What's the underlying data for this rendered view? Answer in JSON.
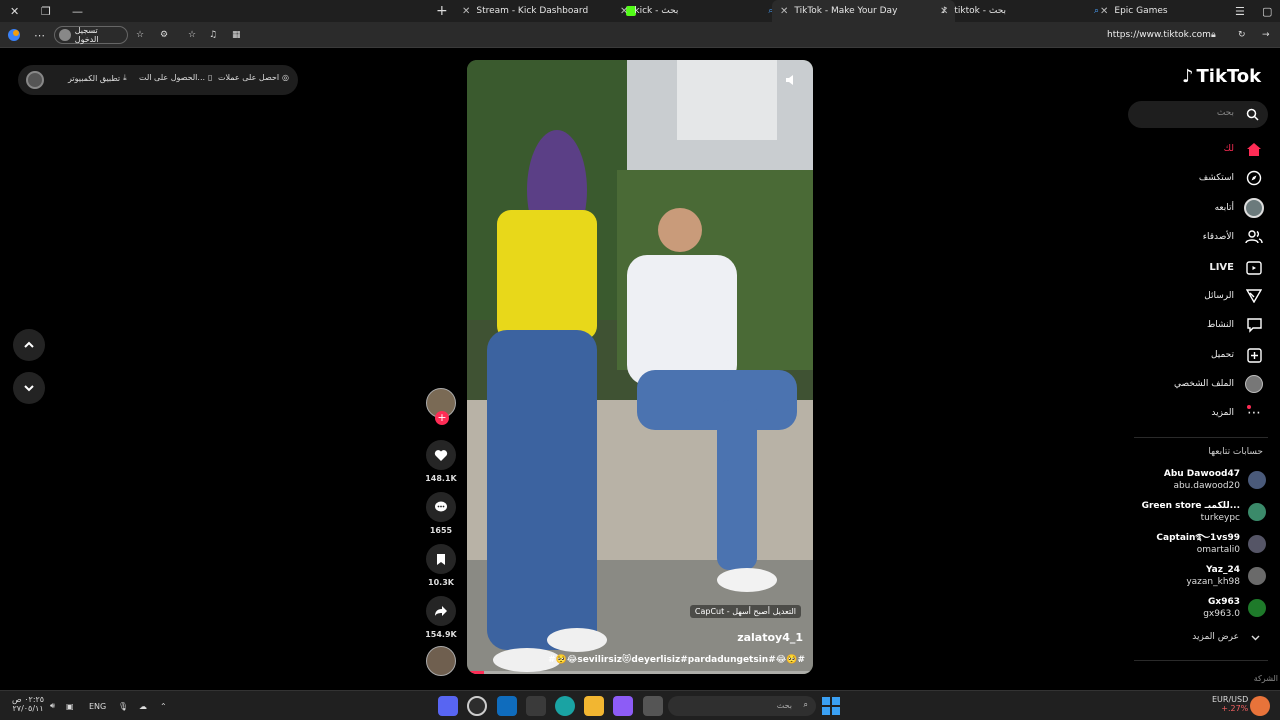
{
  "browser": {
    "tabs": [
      {
        "title": "Stream - Kick Dashboard"
      },
      {
        "title": "kick - بحث"
      },
      {
        "title": "TikTok - Make Your Day"
      },
      {
        "title": "tiktok - بحث"
      },
      {
        "title": "Epic Games"
      }
    ],
    "signin_label": "تسجيل الدخول",
    "url": "https://www.tiktok.com"
  },
  "topbar": {
    "get_coins": "احصل على عملات",
    "get_app": "الحصول على الت...",
    "desktop_app": "تطبيق الكمبيوتر"
  },
  "video": {
    "capcut_label": "CapCut - التعديل أصبح أسهل",
    "author": "zalatoy4_1",
    "caption": "#🥺😂sevilirsiz😻deyerlisiz#pardadungetsin#😂🥺#",
    "progress": 0.05
  },
  "actions": {
    "likes": "148.1K",
    "comments": "1655",
    "saves": "10.3K",
    "shares": "154.9K"
  },
  "sidebar": {
    "logo": "TikTok",
    "search_placeholder": "بحث",
    "nav": [
      {
        "label": "لك",
        "icon": "home-icon"
      },
      {
        "label": "استكشف",
        "icon": "compass-icon"
      },
      {
        "label": "أتابعه",
        "icon": "following-avatar-icon"
      },
      {
        "label": "الأصدقاء",
        "icon": "friends-icon"
      },
      {
        "label": "LIVE",
        "icon": "live-icon"
      },
      {
        "label": "الرسائل",
        "icon": "messages-icon"
      },
      {
        "label": "النشاط",
        "icon": "activity-icon"
      },
      {
        "label": "تحميل",
        "icon": "upload-icon"
      },
      {
        "label": "الملف الشخصي",
        "icon": "profile-icon"
      },
      {
        "label": "المزيد",
        "icon": "more-icon"
      }
    ],
    "following_title": "حسابات تتابعها",
    "accounts": [
      {
        "name": "Abu Dawood47",
        "username": "abu.dawood20",
        "color": "#4a5a7a"
      },
      {
        "name": "Green store للكمبـ...",
        "username": "turkeypc",
        "color": "#3b8a6a"
      },
      {
        "name": "Captain࿐1vs99",
        "username": "omartali0",
        "color": "#555566"
      },
      {
        "name": "Yaz_24",
        "username": "yazan_kh98",
        "color": "#6a6a6a"
      },
      {
        "name": "Gx963",
        "username": "gx963.0",
        "color": "#1e7a2a"
      }
    ],
    "see_more": "عرض المزيد",
    "corner": "الشركة"
  },
  "taskbar": {
    "time": "٠٢:٢٥ ص",
    "date": "٢٧/٠٥/١١",
    "language": "ENG",
    "search_placeholder": "بحث",
    "currency": "EUR/USD",
    "currency_change": "+.27%"
  },
  "colors": {
    "accent": "#fe2c55",
    "background": "#000000"
  }
}
